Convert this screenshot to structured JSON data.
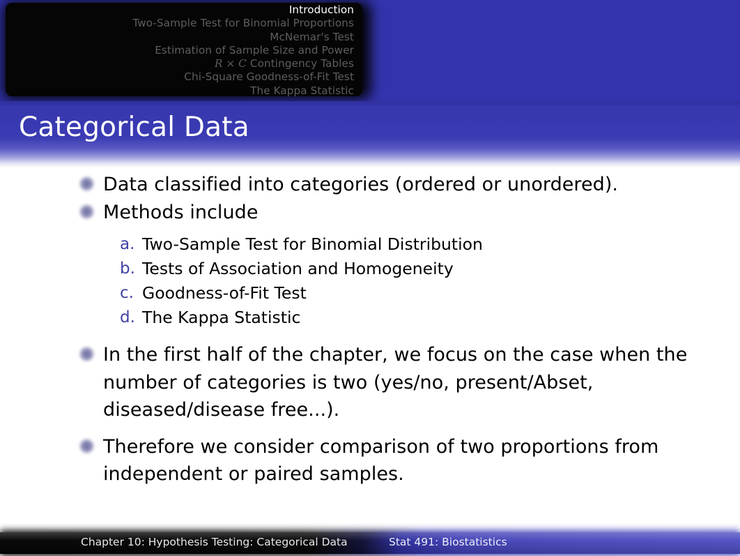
{
  "nav": {
    "items": [
      {
        "label": "Introduction",
        "active": true,
        "math_prefix": ""
      },
      {
        "label": "Two-Sample Test for Binomial Proportions",
        "active": false,
        "math_prefix": ""
      },
      {
        "label": "McNemar's Test",
        "active": false,
        "math_prefix": ""
      },
      {
        "label": "Estimation of Sample Size and Power",
        "active": false,
        "math_prefix": ""
      },
      {
        "label": " Contingency Tables",
        "active": false,
        "math_prefix": "R × C"
      },
      {
        "label": "Chi-Square Goodness-of-Fit Test",
        "active": false,
        "math_prefix": ""
      },
      {
        "label": "The Kappa Statistic",
        "active": false,
        "math_prefix": ""
      }
    ]
  },
  "slide": {
    "title": "Categorical Data",
    "bullets": [
      {
        "text": "Data classified into categories (ordered or unordered)."
      },
      {
        "text": "Methods include"
      },
      {
        "text": "In the first half of the chapter, we focus on the case when the number of categories is two (yes/no, present/Abset, diseased/disease free...)."
      },
      {
        "text": "Therefore we consider comparison of two proportions from independent or paired samples."
      }
    ],
    "enumerated": [
      {
        "marker": "a.",
        "text": "Two-Sample Test for Binomial Distribution"
      },
      {
        "marker": "b.",
        "text": "Tests of Association and Homogeneity"
      },
      {
        "marker": "c.",
        "text": "Goodness-of-Fit Test"
      },
      {
        "marker": "d.",
        "text": "The Kappa Statistic"
      }
    ]
  },
  "footer": {
    "left": "Chapter 10: Hypothesis Testing: Categorical Data",
    "right": "Stat 491: Biostatistics"
  },
  "colors": {
    "accent_blue": "#3333ad",
    "enum_marker": "#4343a8",
    "nav_inactive": "#5e5e5e",
    "nav_active": "#ffffff",
    "body_text": "#000000"
  }
}
